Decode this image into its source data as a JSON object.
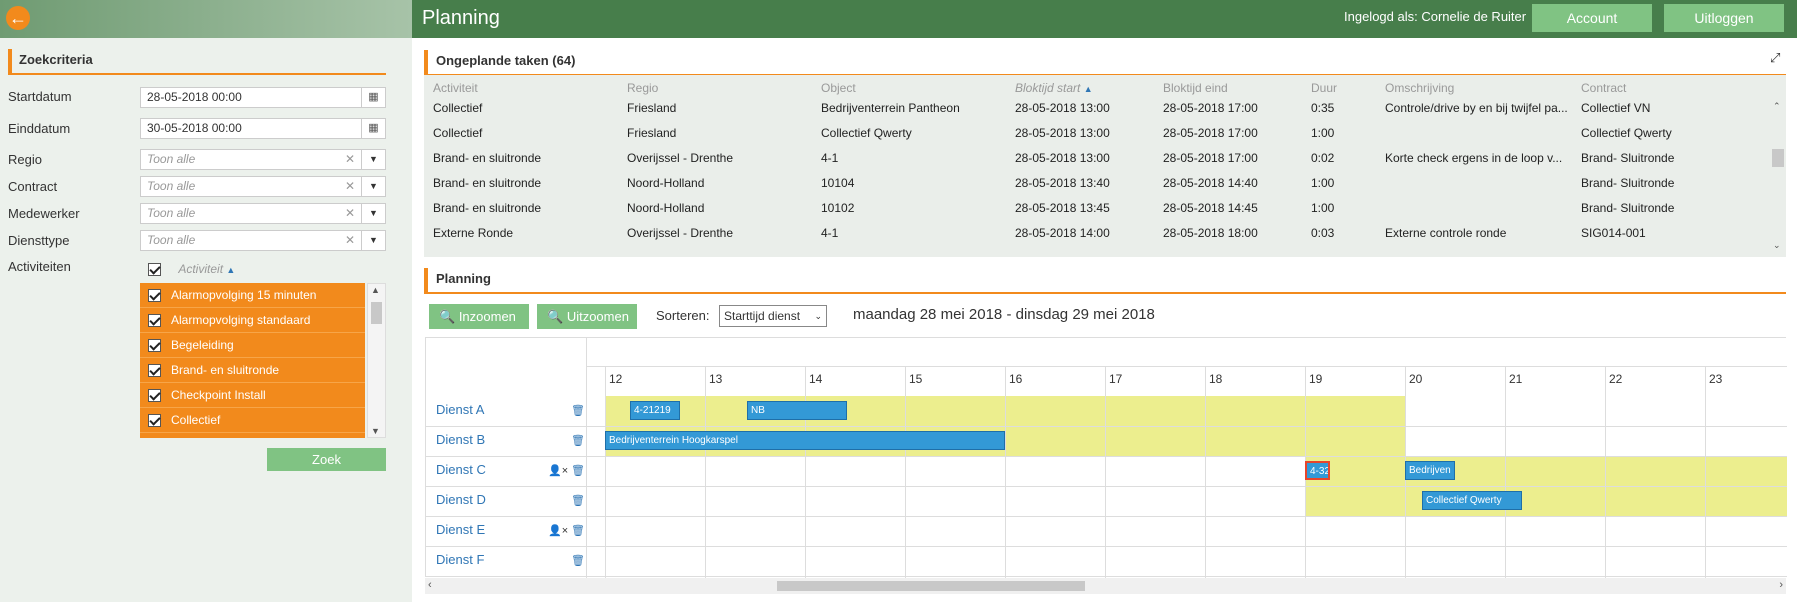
{
  "topbar": {
    "title": "Planning",
    "login_text": "Ingelogd als: Cornelie de Ruiter",
    "account_label": "Account",
    "logout_label": "Uitloggen"
  },
  "colors": {
    "accent": "#f28a1c",
    "header_green": "#477e4b",
    "button_green": "#80c383",
    "link_blue": "#2f76b5",
    "job_blue": "#3399d6",
    "band_yellow": "#ecee8e"
  },
  "search": {
    "title": "Zoekcriteria",
    "startdatum_label": "Startdatum",
    "startdatum_value": "28-05-2018 00:00",
    "einddatum_label": "Einddatum",
    "einddatum_value": "30-05-2018 00:00",
    "regio_label": "Regio",
    "contract_label": "Contract",
    "medewerker_label": "Medewerker",
    "diensttype_label": "Diensttype",
    "placeholder": "Toon alle",
    "activiteiten_label": "Activiteiten",
    "activiteit_col": "Activiteit",
    "activities": [
      "Alarmopvolging 15 minuten",
      "Alarmopvolging standaard",
      "Begeleiding",
      "Brand- en sluitronde",
      "Checkpoint Install",
      "Collectief"
    ],
    "zoek_label": "Zoek"
  },
  "unplanned": {
    "title": "Ongeplande taken (64)",
    "columns": [
      "Activiteit",
      "Regio",
      "Object",
      "Bloktijd start",
      "Bloktijd eind",
      "Duur",
      "Omschrijving",
      "Contract"
    ],
    "rows": [
      [
        "Collectief",
        "Friesland",
        "Bedrijventerrein Pantheon",
        "28-05-2018 13:00",
        "28-05-2018 17:00",
        "0:35",
        "Controle/drive by en bij twijfel pa...",
        "Collectief VN"
      ],
      [
        "Collectief",
        "Friesland",
        "Collectief Qwerty",
        "28-05-2018 13:00",
        "28-05-2018 17:00",
        "1:00",
        "",
        "Collectief Qwerty"
      ],
      [
        "Brand- en sluitronde",
        "Overijssel - Drenthe",
        "4-1",
        "28-05-2018 13:00",
        "28-05-2018 17:00",
        "0:02",
        "Korte check ergens in de loop v...",
        "Brand- Sluitronde"
      ],
      [
        "Brand- en sluitronde",
        "Noord-Holland",
        "10104",
        "28-05-2018 13:40",
        "28-05-2018 14:40",
        "1:00",
        "",
        "Brand- Sluitronde"
      ],
      [
        "Brand- en sluitronde",
        "Noord-Holland",
        "10102",
        "28-05-2018 13:45",
        "28-05-2018 14:45",
        "1:00",
        "",
        "Brand- Sluitronde"
      ],
      [
        "Externe Ronde",
        "Overijssel - Drenthe",
        "4-1",
        "28-05-2018 14:00",
        "28-05-2018 18:00",
        "0:03",
        "Externe controle ronde",
        "SIG014-001"
      ]
    ]
  },
  "planning": {
    "title": "Planning",
    "inzoomen_label": "Inzoomen",
    "uitzoomen_label": "Uitzoomen",
    "sort_label": "Sorteren:",
    "sort_value": "Starttijd dienst",
    "date_range": "maandag 28 mei 2018 - dinsdag 29 mei 2018",
    "hours": [
      "12",
      "13",
      "14",
      "15",
      "16",
      "17",
      "18",
      "19",
      "20",
      "21",
      "22",
      "23"
    ],
    "rows": [
      {
        "name": "Dienst A",
        "unassign": false
      },
      {
        "name": "Dienst B",
        "unassign": false
      },
      {
        "name": "Dienst C",
        "unassign": true
      },
      {
        "name": "Dienst D",
        "unassign": false
      },
      {
        "name": "Dienst E",
        "unassign": true
      },
      {
        "name": "Dienst F",
        "unassign": false
      }
    ],
    "shift_bands": [
      {
        "row": 0,
        "start": 12,
        "end": 20
      },
      {
        "row": 1,
        "start": 12,
        "end": 20
      },
      {
        "row": 2,
        "start": 19,
        "end": 24
      },
      {
        "row": 3,
        "start": 19,
        "end": 24
      }
    ],
    "jobs": [
      {
        "row": 0,
        "label": "4-21219",
        "start": 12.25,
        "end": 12.75
      },
      {
        "row": 0,
        "label": "NB",
        "start": 13.42,
        "end": 14.42
      },
      {
        "row": 1,
        "label": "Bedrijventerrein Hoogkarspel",
        "start": 12.0,
        "end": 16.0
      },
      {
        "row": 2,
        "label": "4-32",
        "start": 19.0,
        "end": 19.25,
        "highlight": true
      },
      {
        "row": 2,
        "label": "Bedrijven",
        "start": 20.0,
        "end": 20.5
      },
      {
        "row": 3,
        "label": "Collectief Qwerty",
        "start": 20.17,
        "end": 21.17
      }
    ]
  }
}
